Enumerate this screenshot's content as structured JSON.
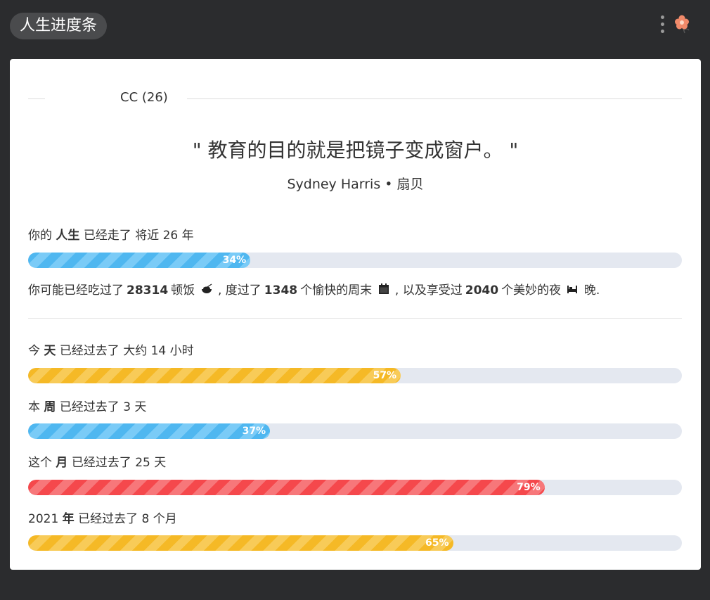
{
  "app": {
    "title": "人生进度条"
  },
  "profile": {
    "name": "CC (26)"
  },
  "quote": {
    "text": "\" 教育的目的就是把镜子变成窗户。 \"",
    "author": "Sydney Harris • 扇贝"
  },
  "life": {
    "label_prefix": "你的",
    "label_bold": "人生",
    "label_suffix": "已经走了 将近 26 年",
    "percent": 34,
    "percent_label": "34%",
    "color": "#4fb7f0"
  },
  "stats": {
    "t1": "你可能已经吃过了",
    "meals": "28314",
    "t2": "顿饭",
    "t3": ", 度过了",
    "weekends": "1348",
    "t4": "个愉快的周末",
    "t5": ", 以及享受过",
    "nights": "2040",
    "t6": "个美妙的夜",
    "t7": "晚."
  },
  "progress": [
    {
      "prefix": "今",
      "bold": "天",
      "suffix": "已经过去了 大约 14 小时",
      "percent": 57,
      "percent_label": "57%",
      "color": "#f5b926"
    },
    {
      "prefix": "本",
      "bold": "周",
      "suffix": "已经过去了 3 天",
      "percent": 37,
      "percent_label": "37%",
      "color": "#4fb7f0"
    },
    {
      "prefix": "这个",
      "bold": "月",
      "suffix": "已经过去了 25 天",
      "percent": 79,
      "percent_label": "79%",
      "color": "#f5484c"
    },
    {
      "prefix": "2021",
      "bold": "年",
      "suffix": "已经过去了 8 个月",
      "percent": 65,
      "percent_label": "65%",
      "color": "#f5b926"
    }
  ],
  "icons": {
    "menu": "more-vertical-icon",
    "avatar": "flower-icon",
    "meal": "rice-bowl-icon",
    "weekend": "calendar-icon",
    "night": "bed-icon"
  }
}
